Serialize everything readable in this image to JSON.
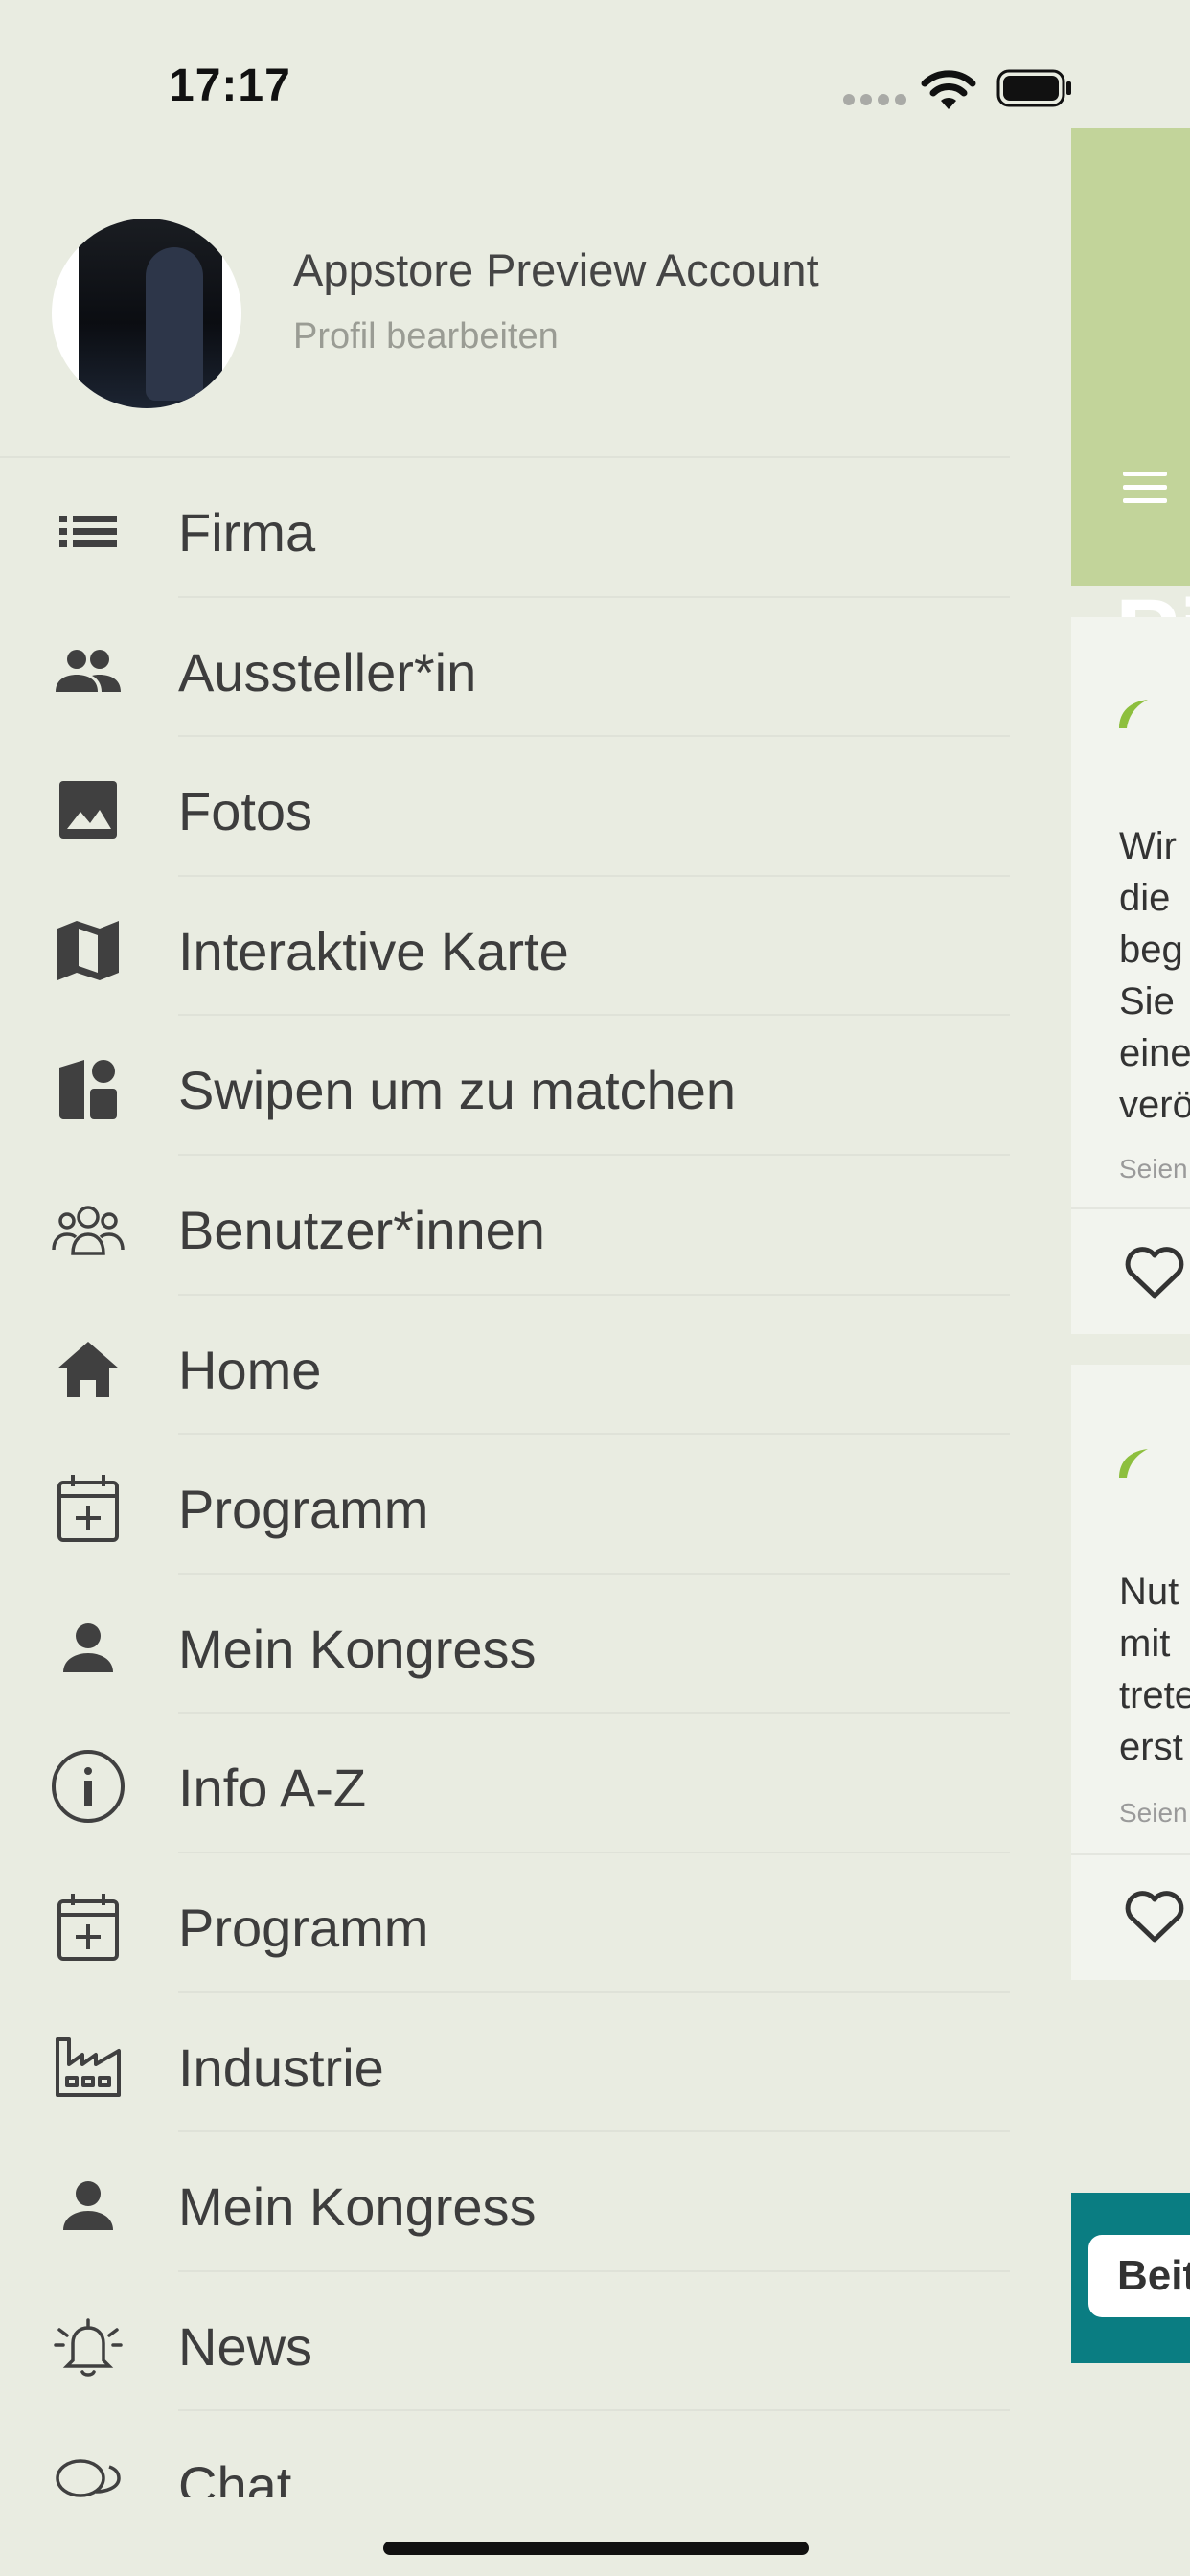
{
  "status_bar": {
    "time": "17:17"
  },
  "profile": {
    "name": "Appstore Preview Account",
    "edit_label": "Profil bearbeiten"
  },
  "menu": {
    "items": [
      {
        "label": "Firma",
        "icon": "list-icon"
      },
      {
        "label": "Aussteller*in",
        "icon": "people-icon"
      },
      {
        "label": "Fotos",
        "icon": "image-icon"
      },
      {
        "label": "Interaktive Karte",
        "icon": "map-icon"
      },
      {
        "label": "Swipen um zu matchen",
        "icon": "swipe-match-icon"
      },
      {
        "label": "Benutzer*innen",
        "icon": "users-outline-icon"
      },
      {
        "label": "Home",
        "icon": "home-icon"
      },
      {
        "label": "Programm",
        "icon": "calendar-plus-icon"
      },
      {
        "label": "Mein Kongress",
        "icon": "person-icon"
      },
      {
        "label": "Info A-Z",
        "icon": "info-icon"
      },
      {
        "label": "Programm",
        "icon": "calendar-plus-icon"
      },
      {
        "label": "Industrie",
        "icon": "factory-icon"
      },
      {
        "label": "Mein Kongress",
        "icon": "person-icon"
      },
      {
        "label": "News",
        "icon": "bell-icon"
      },
      {
        "label": "Chat",
        "icon": "chat-icon"
      }
    ]
  },
  "background_screen": {
    "title_partial": "Pi",
    "cards": [
      {
        "lines": [
          "Wir",
          "die",
          "beg",
          "Sie",
          "eine",
          "verö"
        ],
        "sub": "Seien"
      },
      {
        "lines": [
          "Nut",
          "mit",
          "trete",
          "erst"
        ],
        "sub": "Seien"
      }
    ],
    "banner_button_partial": "Beit"
  },
  "colors": {
    "background": "#e9ece1",
    "header_green": "#c2d49a",
    "banner_teal": "#0a7d82",
    "text": "#3d3d3d"
  }
}
